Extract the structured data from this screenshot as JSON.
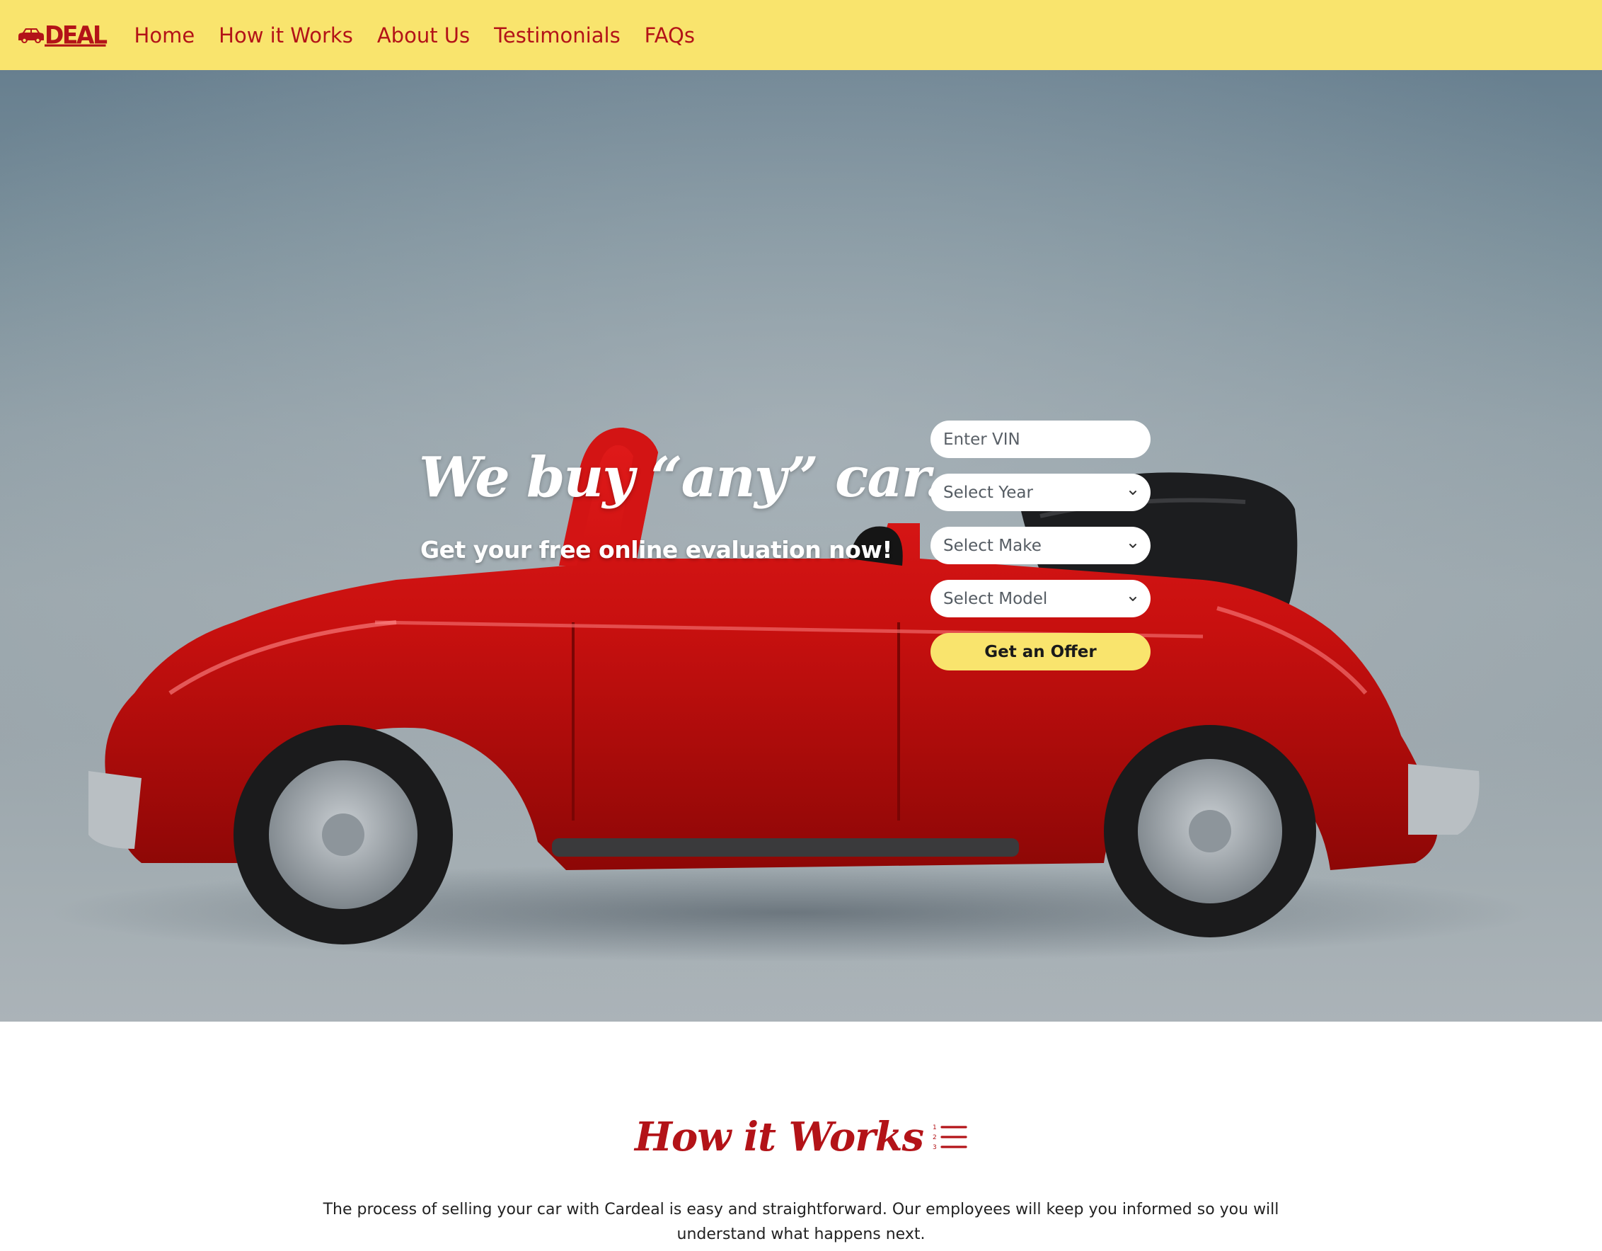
{
  "brand": {
    "logo_text": "DEAL",
    "logo_icon": "car-icon",
    "colors": {
      "primary_red": "#b31318",
      "accent_yellow": "#f9e46d"
    }
  },
  "nav": {
    "items": [
      {
        "label": "Home"
      },
      {
        "label": "How it Works"
      },
      {
        "label": "About Us"
      },
      {
        "label": "Testimonials"
      },
      {
        "label": "FAQs"
      }
    ]
  },
  "hero": {
    "headline": "We buy “any” car.",
    "subheadline": "Get your free online evaluation now!",
    "form": {
      "vin_placeholder": "Enter VIN",
      "vin_value": "",
      "year_select": "Select Year",
      "make_select": "Select Make",
      "model_select": "Select Model",
      "submit_label": "Get an Offer"
    }
  },
  "how_it_works": {
    "title": "How it Works",
    "icon": "numbered-list-icon",
    "description": "The process of selling your car with Cardeal is easy and straightforward. Our employees will keep you informed so you will understand what happens next."
  }
}
